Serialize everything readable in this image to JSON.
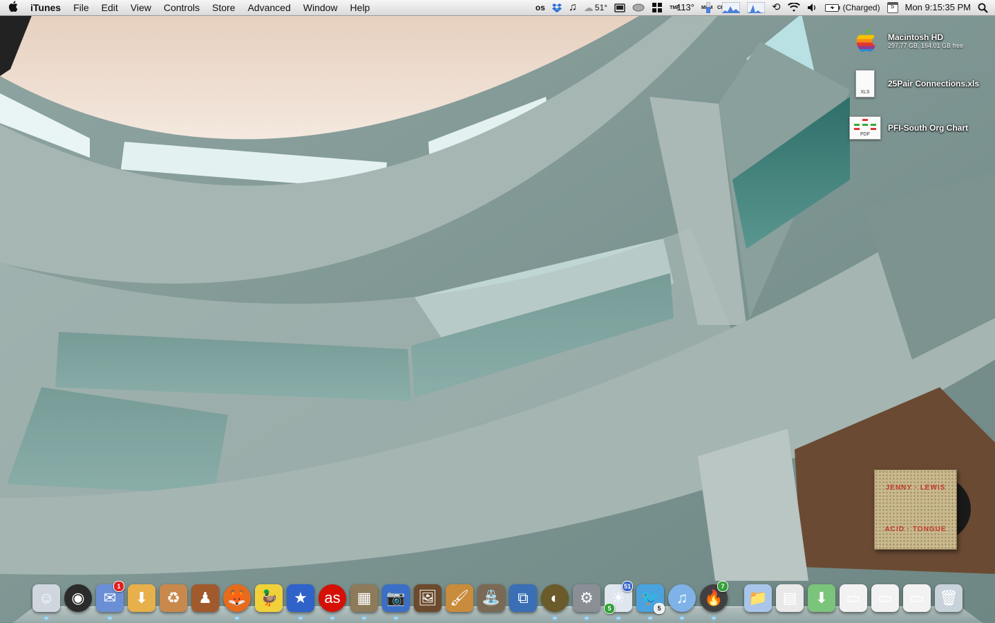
{
  "menubar": {
    "apple": "",
    "app_name": "iTunes",
    "menus": [
      "File",
      "Edit",
      "View",
      "Controls",
      "Store",
      "Advanced",
      "Window",
      "Help"
    ],
    "status": {
      "lastfm": "ᴏѕ",
      "weather_temp": "51°",
      "temp_label_top": "TMP",
      "cpu_temp": "113°",
      "mem_label": "MEM",
      "cpu_label": "CPU",
      "battery_status": "(Charged)",
      "calendar_day": "5",
      "clock": "Mon 9:15:35 PM"
    }
  },
  "desktop": {
    "icons": [
      {
        "label": "Macintosh HD",
        "sublabel": "297.77 GB, 164.01 GB free",
        "icon": "hard-drive-icon"
      },
      {
        "label": "25Pair Connections.xls",
        "tag": "XLS",
        "icon": "xls-file-icon"
      },
      {
        "label": "PFI-South Org Chart",
        "tag": "PDF",
        "icon": "pdf-file-icon"
      }
    ]
  },
  "now_playing": {
    "artist_art_text": "JENNY · LEWIS",
    "album_art_text": "ACID · TONGUE"
  },
  "dock": {
    "apps": [
      {
        "name": "finder-icon",
        "glyph": "☺"
      },
      {
        "name": "dashboard-icon",
        "glyph": "◉"
      },
      {
        "name": "mail-icon",
        "glyph": "✉",
        "badge": "1"
      },
      {
        "name": "downloader-icon",
        "glyph": "⬇"
      },
      {
        "name": "unarchiver-icon",
        "glyph": "♻"
      },
      {
        "name": "chess-icon",
        "glyph": "♟"
      },
      {
        "name": "firefox-icon",
        "glyph": "🦊"
      },
      {
        "name": "cyberduck-icon",
        "glyph": "🦆"
      },
      {
        "name": "colloquy-icon",
        "glyph": "★"
      },
      {
        "name": "lastfm-icon",
        "glyph": "as"
      },
      {
        "name": "notepad-icon",
        "glyph": "▦"
      },
      {
        "name": "image-capture-icon",
        "glyph": "📷"
      },
      {
        "name": "iphoto-icon",
        "glyph": "🖼"
      },
      {
        "name": "preview-icon",
        "glyph": "🖌"
      },
      {
        "name": "wishing-well-icon",
        "glyph": "⛲"
      },
      {
        "name": "vmware-icon",
        "glyph": "⧉"
      },
      {
        "name": "clock-icon",
        "glyph": "◐"
      },
      {
        "name": "system-preferences-icon",
        "glyph": "⚙"
      },
      {
        "name": "calendar-icon",
        "glyph": "☀",
        "badge": "51",
        "badge2": "5"
      },
      {
        "name": "twitter-icon",
        "glyph": "🐦",
        "badge2": "5"
      },
      {
        "name": "itunes-icon",
        "glyph": "♫"
      },
      {
        "name": "campfire-icon",
        "glyph": "🔥",
        "badge": "7"
      }
    ],
    "stacks": [
      {
        "name": "documents-stack-icon",
        "glyph": "📁"
      },
      {
        "name": "org-chart-stack-icon",
        "glyph": "▤"
      },
      {
        "name": "downloads-stack-icon",
        "glyph": "⬇"
      },
      {
        "name": "minimized-window-1-icon",
        "glyph": "▭"
      },
      {
        "name": "minimized-window-2-icon",
        "glyph": "▭"
      },
      {
        "name": "minimized-window-3-icon",
        "glyph": "▭"
      },
      {
        "name": "trash-icon",
        "glyph": "🗑"
      }
    ]
  },
  "colors": {
    "menubar_bg": "#e8e8e8",
    "badge_red": "#e0201c",
    "badge_green": "#35a13a"
  }
}
